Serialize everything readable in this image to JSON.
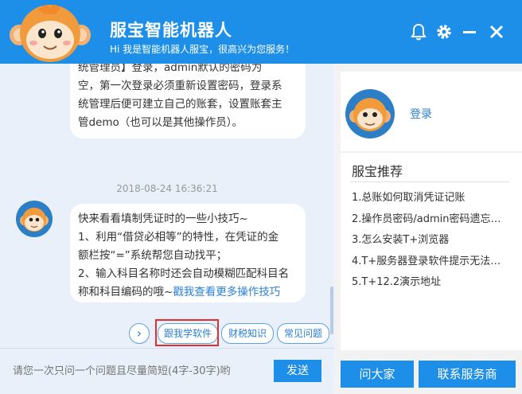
{
  "header": {
    "title": "服宝智能机器人",
    "subtitle": "Hi 我是智能机器人服宝，很高兴为您服务！",
    "icons": [
      "bell-icon",
      "gear-icon",
      "minimize-icon",
      "close-icon"
    ],
    "bg_color": "#1e8fe8"
  },
  "chat": {
    "message1": {
      "lines": [
        "统管理员】登录，admin默认的密码为",
        "空，第一次登录必须重新设置密码，登录系",
        "统管理后便可建立自己的账套，设置账套主",
        "管demo（也可以是其他操作员）。"
      ]
    },
    "timestamp": "2018-08-24 16:36:21",
    "message2": {
      "lines": [
        "快来看看填制凭证时的一些小技巧~",
        "1、利用“借贷必相等”的特性，在凭证的金",
        "额栏按“=”系统帮您自动找平；",
        "2、输入科目名称时还会自动模糊匹配科目名"
      ],
      "last_prefix": "称和科目编码的哦~",
      "link_text": "戳我查看更多操作技巧"
    }
  },
  "quick_buttons": {
    "next_symbol": "›",
    "items": [
      "跟我学软件",
      "财税知识",
      "常见问题"
    ]
  },
  "input": {
    "placeholder": "请您一次只问一个问题且尽量简短(4字-30字)哟",
    "send_label": "发送"
  },
  "right_panel": {
    "login_label": "登录",
    "recommend_title": "服宝推荐",
    "recommend_items": [
      "1.总账如何取消凭证记账",
      "2.操作员密码/admin密码遗忘…",
      "3.怎么安装T+浏览器",
      "4.T+服务器登录软件提示无法…",
      "5.T+12.2演示地址"
    ],
    "ask_all_label": "问大家",
    "contact_label": "联系服务商"
  },
  "colors": {
    "accent": "#1e8fe8",
    "link": "#2a7fd6",
    "highlight_box": "#e0312f"
  }
}
